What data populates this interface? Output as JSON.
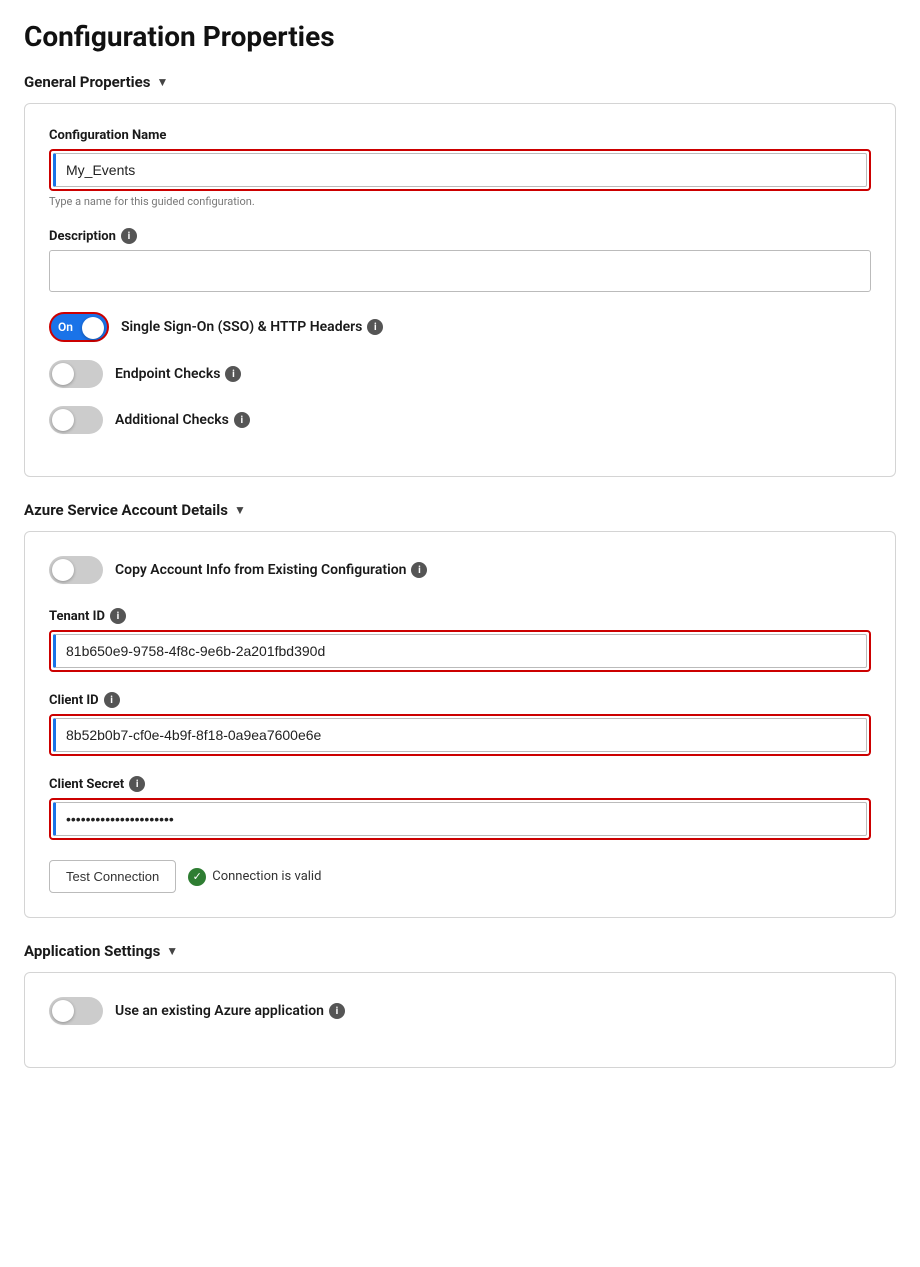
{
  "page": {
    "title": "Configuration Properties"
  },
  "general_properties": {
    "section_label": "General Properties",
    "config_name": {
      "label": "Configuration Name",
      "value": "My_Events",
      "hint": "Type a name for this guided configuration."
    },
    "description": {
      "label": "Description",
      "info_label": "i",
      "value": ""
    },
    "sso_toggle": {
      "label": "Single Sign-On (SSO) & HTTP Headers",
      "state": "on",
      "state_label": "On"
    },
    "endpoint_checks": {
      "label": "Endpoint Checks",
      "state": "off"
    },
    "additional_checks": {
      "label": "Additional Checks",
      "state": "off"
    }
  },
  "azure_service": {
    "section_label": "Azure Service Account Details",
    "copy_account": {
      "label": "Copy Account Info from Existing Configuration",
      "state": "off"
    },
    "tenant_id": {
      "label": "Tenant ID",
      "value": "81b650e9-9758-4f8c-9e6b-2a201fbd390d"
    },
    "client_id": {
      "label": "Client ID",
      "value": "8b52b0b7-cf0e-4b9f-8f18-0a9ea7600e6e"
    },
    "client_secret": {
      "label": "Client Secret",
      "value": "••••••••••••••••••••••••••••"
    },
    "test_button_label": "Test Connection",
    "connection_status": "Connection is valid"
  },
  "application_settings": {
    "section_label": "Application Settings",
    "use_existing": {
      "label": "Use an existing Azure application",
      "state": "off"
    }
  },
  "icons": {
    "info": "i",
    "chevron_down": "▼",
    "check": "✓"
  }
}
